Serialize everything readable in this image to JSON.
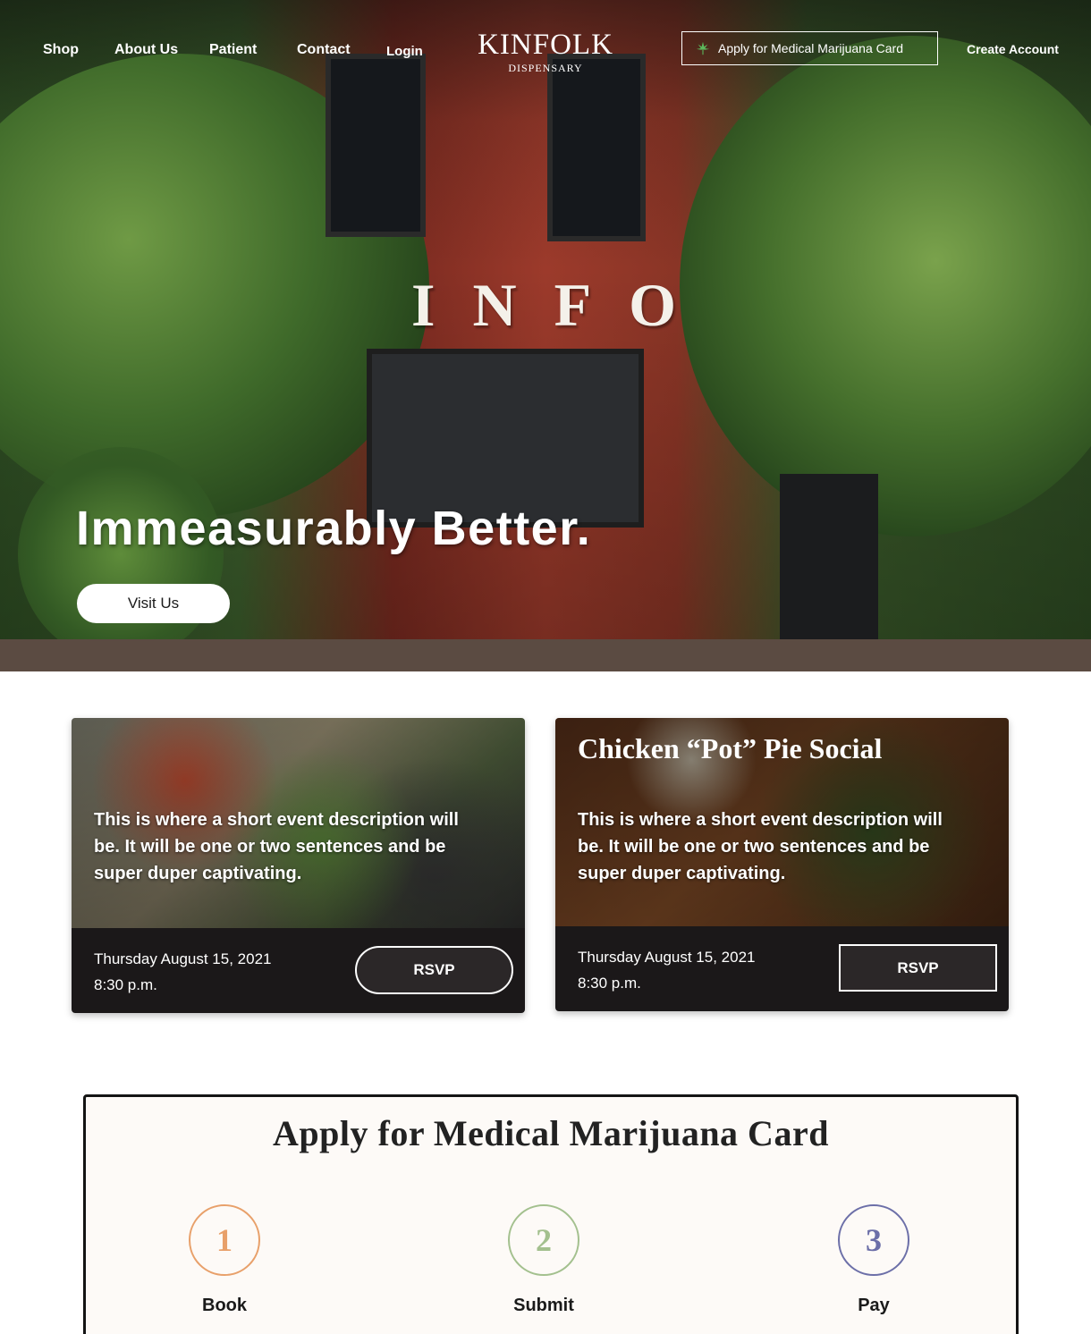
{
  "nav": {
    "links": [
      "Shop",
      "About Us",
      "Patient",
      "Contact",
      "Login"
    ],
    "logo_main": "KINFOLK",
    "logo_sub": "DISPENSARY",
    "apply_label": "Apply for Medical Marijuana Card",
    "create_account": "Create Account"
  },
  "hero": {
    "building_letters": "INFO",
    "title": "Immeasurably Better.",
    "cta": "Visit Us"
  },
  "events": [
    {
      "title": "",
      "description": "This is where a short event description will be. It will be one or two sentences and be super duper captivating.",
      "date": "Thursday August 15, 2021",
      "time": "8:30 p.m.",
      "rsvp": "RSVP"
    },
    {
      "title": "Chicken “Pot” Pie Social",
      "description": "This is where a short event description will be. It will be one or two sentences and be super duper captivating.",
      "date": "Thursday August 15, 2021",
      "time": "8:30 p.m.",
      "rsvp": "RSVP"
    }
  ],
  "apply": {
    "title": "Apply for Medical Marijuana Card",
    "steps": [
      {
        "number": "1",
        "label": "Book",
        "color": "#e8a06a"
      },
      {
        "number": "2",
        "label": "Submit",
        "color": "#a3c08e"
      },
      {
        "number": "3",
        "label": "Pay",
        "color": "#6c6fa8"
      }
    ]
  },
  "icons": {
    "apply_icon": "cannabis-leaf-icon"
  },
  "colors": {
    "card_footer": "#1b1819",
    "apply_bg": "#fdfaf7",
    "leaf_green": "#5cb85c"
  }
}
